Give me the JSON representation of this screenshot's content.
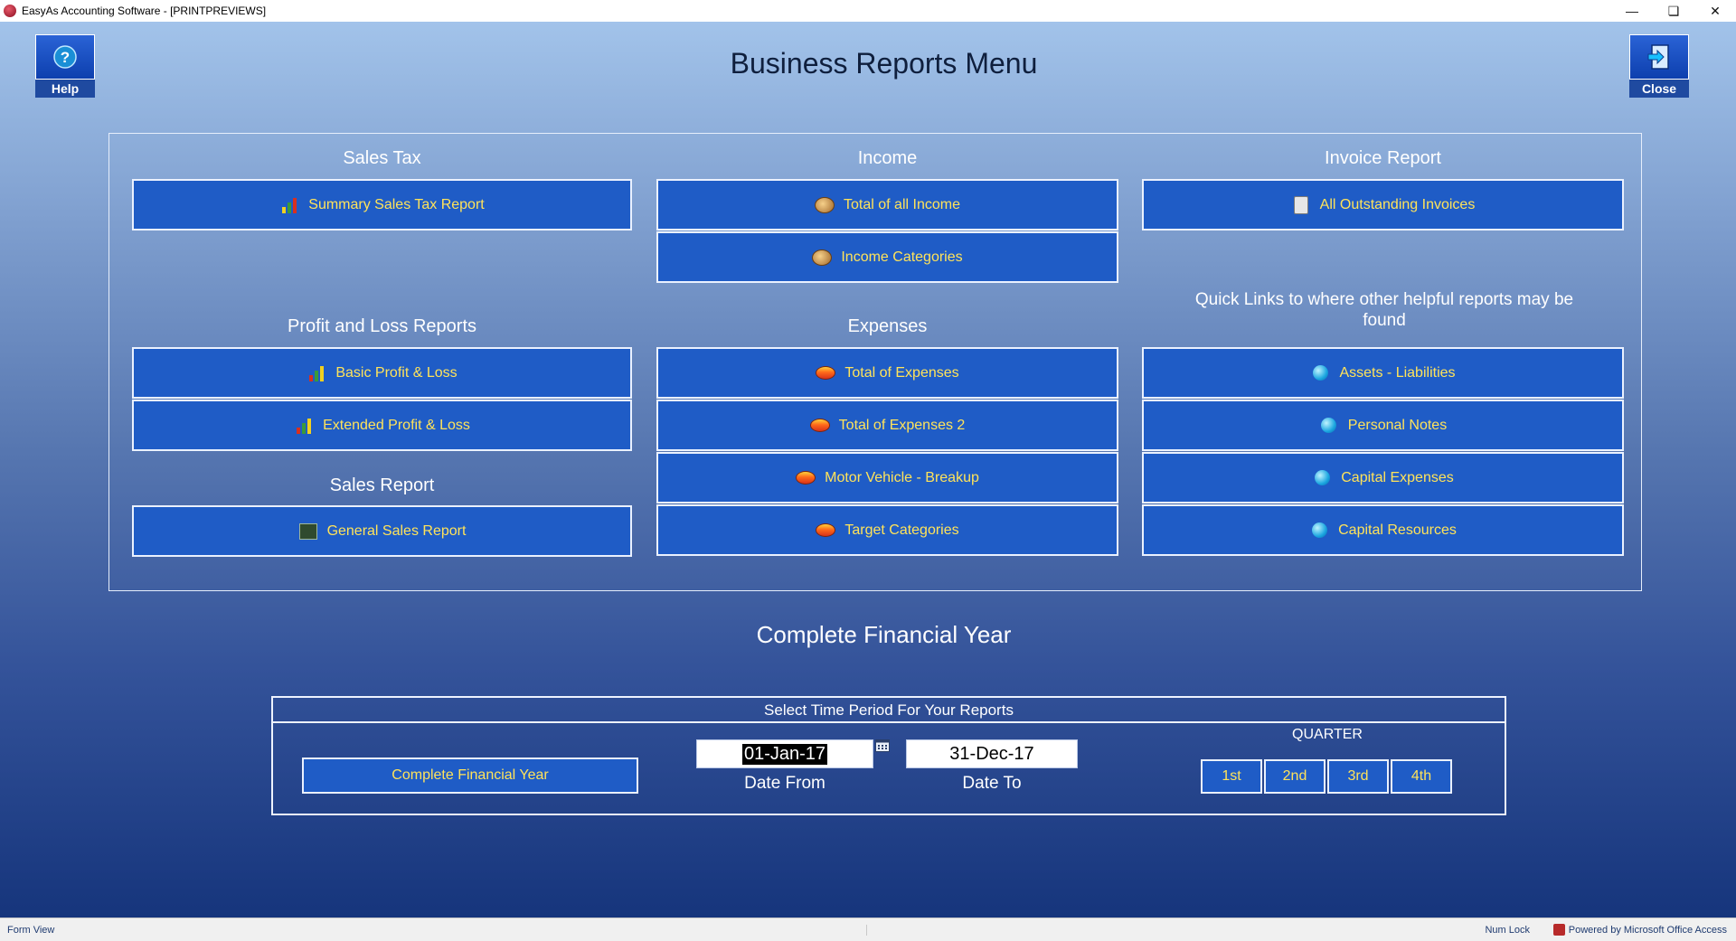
{
  "window": {
    "title": "EasyAs Accounting Software - [PRINTPREVIEWS]"
  },
  "header": {
    "title": "Business Reports Menu",
    "help_label": "Help",
    "close_label": "Close"
  },
  "sections": {
    "sales_tax": {
      "title": "Sales Tax",
      "buttons": [
        "Summary Sales Tax Report"
      ]
    },
    "income": {
      "title": "Income",
      "buttons": [
        "Total of all Income",
        "Income Categories"
      ]
    },
    "invoice": {
      "title": "Invoice Report",
      "buttons": [
        "All Outstanding Invoices"
      ]
    },
    "profit_loss": {
      "title": "Profit and Loss Reports",
      "buttons": [
        "Basic Profit & Loss",
        "Extended Profit & Loss"
      ]
    },
    "expenses": {
      "title": "Expenses",
      "buttons": [
        "Total of Expenses",
        "Total of Expenses 2",
        "Motor Vehicle - Breakup",
        "Target Categories"
      ]
    },
    "quick_links": {
      "title": "Quick Links to where other helpful reports may be found",
      "buttons": [
        "Assets - Liabilities",
        "Personal Notes",
        "Capital Expenses",
        "Capital Resources"
      ]
    },
    "sales_report": {
      "title": "Sales Report",
      "buttons": [
        "General Sales Report"
      ]
    }
  },
  "period": {
    "heading": "Complete Financial Year",
    "box_title": "Select Time Period For Your Reports",
    "full_year_button": "Complete Financial Year",
    "date_from": "01-Jan-17",
    "date_to": "31-Dec-17",
    "date_from_label": "Date  From",
    "date_to_label": "Date  To",
    "quarter_label": "QUARTER",
    "quarters": [
      "1st",
      "2nd",
      "3rd",
      "4th"
    ]
  },
  "status": {
    "left": "Form View",
    "num_lock": "Num Lock",
    "powered": "Powered by Microsoft Office Access"
  },
  "colors": {
    "button_fill": "#1f5cc6",
    "button_text": "#ffe35a",
    "title_text": "#0f1f3d"
  }
}
